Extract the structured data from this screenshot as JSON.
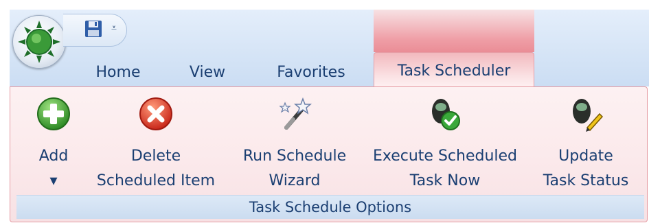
{
  "window": {
    "qat": {
      "dropdown_glyph": "⩡"
    },
    "tabs": [
      {
        "label": "Home"
      },
      {
        "label": "View"
      },
      {
        "label": "Favorites"
      },
      {
        "label": "Task Scheduler",
        "active": true
      }
    ],
    "context_color": "#ef9ea6",
    "ribbon": {
      "buttons": [
        {
          "line1": "Add",
          "line2": "▾",
          "icon": "add-icon"
        },
        {
          "line1": "Delete",
          "line2": "Scheduled Item",
          "icon": "delete-icon"
        },
        {
          "line1": "Run Schedule",
          "line2": "Wizard",
          "icon": "magic-wand-icon"
        },
        {
          "line1": "Execute Scheduled",
          "line2": "Task Now",
          "icon": "execute-task-icon"
        },
        {
          "line1": "Update",
          "line2": "Task Status",
          "icon": "update-status-icon"
        }
      ],
      "group_label": "Task Schedule Options"
    }
  }
}
